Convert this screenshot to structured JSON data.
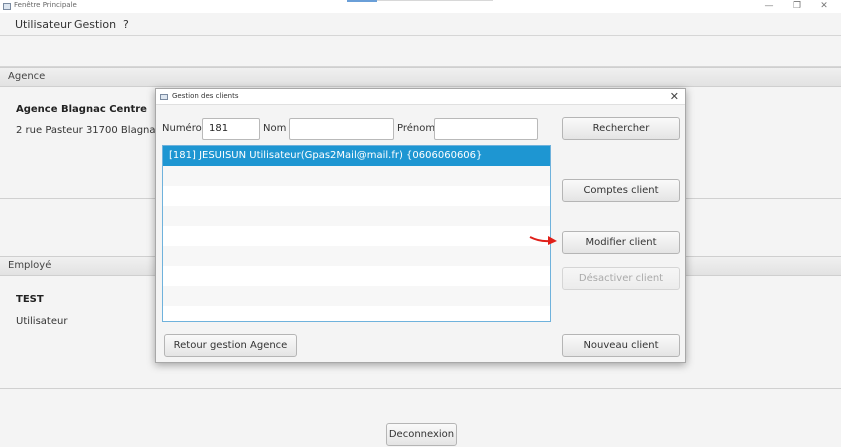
{
  "window": {
    "title": "Fenêtre Principale",
    "minimize": "—",
    "restore": "❐",
    "close": "✕"
  },
  "menu": {
    "items": [
      "Utilisateur",
      "Gestion",
      "?"
    ]
  },
  "agence": {
    "header": "Agence",
    "name": "Agence Blagnac Centre",
    "address": "2 rue Pasteur 31700 Blagnac"
  },
  "employe": {
    "header": "Employé",
    "name": "TEST",
    "role": "Utilisateur"
  },
  "footer": {
    "logout_label": "Deconnexion"
  },
  "dialog": {
    "title": "Gestion des clients",
    "close": "✕",
    "search": {
      "numero_label": "Numéro",
      "numero_value": "181",
      "nom_label": "Nom",
      "nom_value": "",
      "prenom_label": "Prénom",
      "prenom_value": ""
    },
    "clients": [
      "[181]  JESUISUN Utilisateur(Gpas2Mail@mail.fr)  {0606060606}"
    ],
    "selected_index": 0,
    "buttons": {
      "rechercher": "Rechercher",
      "comptes": "Comptes client",
      "modifier": "Modifier client",
      "desactiver": "Désactiver client",
      "nouveau": "Nouveau client",
      "retour": "Retour gestion Agence"
    },
    "colors": {
      "selection": "#1e96d2",
      "annotation_arrow": "#e0201a"
    }
  }
}
